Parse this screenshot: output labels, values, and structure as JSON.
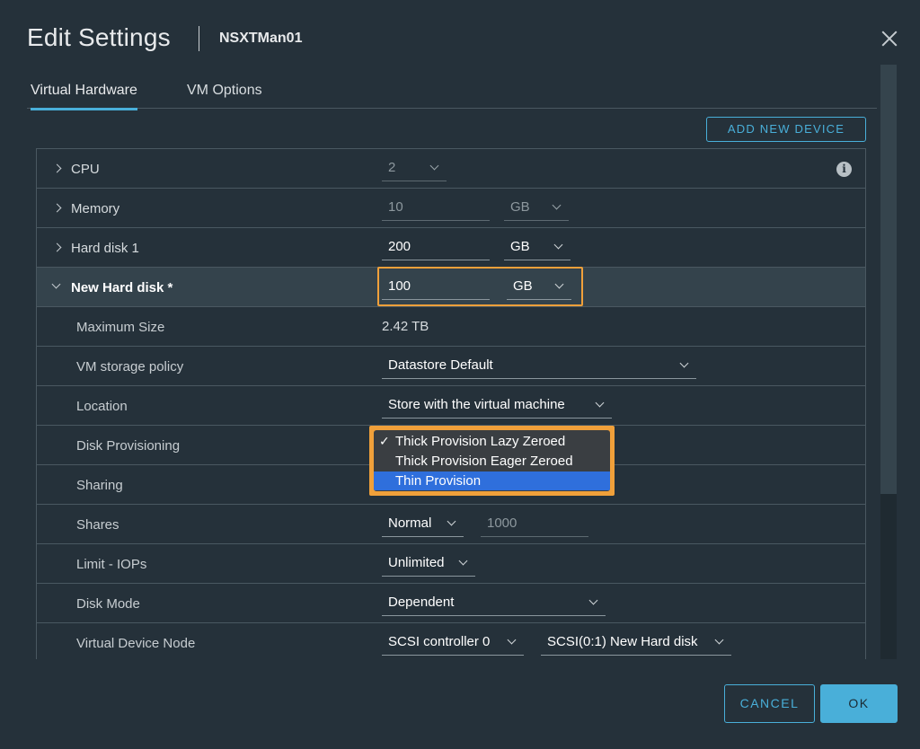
{
  "header": {
    "title": "Edit Settings",
    "vm_name": "NSXTMan01"
  },
  "tabs": [
    {
      "label": "Virtual Hardware",
      "active": true
    },
    {
      "label": "VM Options",
      "active": false
    }
  ],
  "toolbar": {
    "add_new_device_label": "ADD NEW DEVICE"
  },
  "rows": {
    "cpu": {
      "label": "CPU",
      "value": "2"
    },
    "memory": {
      "label": "Memory",
      "value": "10",
      "unit": "GB"
    },
    "hard_disk_1": {
      "label": "Hard disk 1",
      "value": "200",
      "unit": "GB"
    },
    "new_hard_disk": {
      "label": "New Hard disk *",
      "value": "100",
      "unit": "GB"
    },
    "maximum_size": {
      "label": "Maximum Size",
      "value": "2.42 TB"
    },
    "storage_policy": {
      "label": "VM storage policy",
      "value": "Datastore Default"
    },
    "location": {
      "label": "Location",
      "value": "Store with the virtual machine"
    },
    "disk_provisioning": {
      "label": "Disk Provisioning"
    },
    "sharing": {
      "label": "Sharing"
    },
    "shares": {
      "label": "Shares",
      "value": "Normal",
      "number": "1000"
    },
    "limit_iops": {
      "label": "Limit - IOPs",
      "value": "Unlimited"
    },
    "disk_mode": {
      "label": "Disk Mode",
      "value": "Dependent"
    },
    "virtual_device_node": {
      "label": "Virtual Device Node",
      "controller": "SCSI controller 0",
      "node": "SCSI(0:1) New Hard disk"
    }
  },
  "provisioning_dropdown": {
    "options": [
      {
        "label": "Thick Provision Lazy Zeroed",
        "checked": true,
        "highlighted": false
      },
      {
        "label": "Thick Provision Eager Zeroed",
        "checked": false,
        "highlighted": false
      },
      {
        "label": "Thin Provision",
        "checked": false,
        "highlighted": true
      }
    ],
    "check_glyph": "✓"
  },
  "footer": {
    "cancel_label": "CANCEL",
    "ok_label": "OK"
  },
  "colors": {
    "accent": "#49afd9",
    "highlight": "#f0a03a",
    "selected_option": "#2f6fdc",
    "background": "#25313a"
  },
  "icons": {
    "close": "close-icon",
    "info": "info-icon"
  }
}
